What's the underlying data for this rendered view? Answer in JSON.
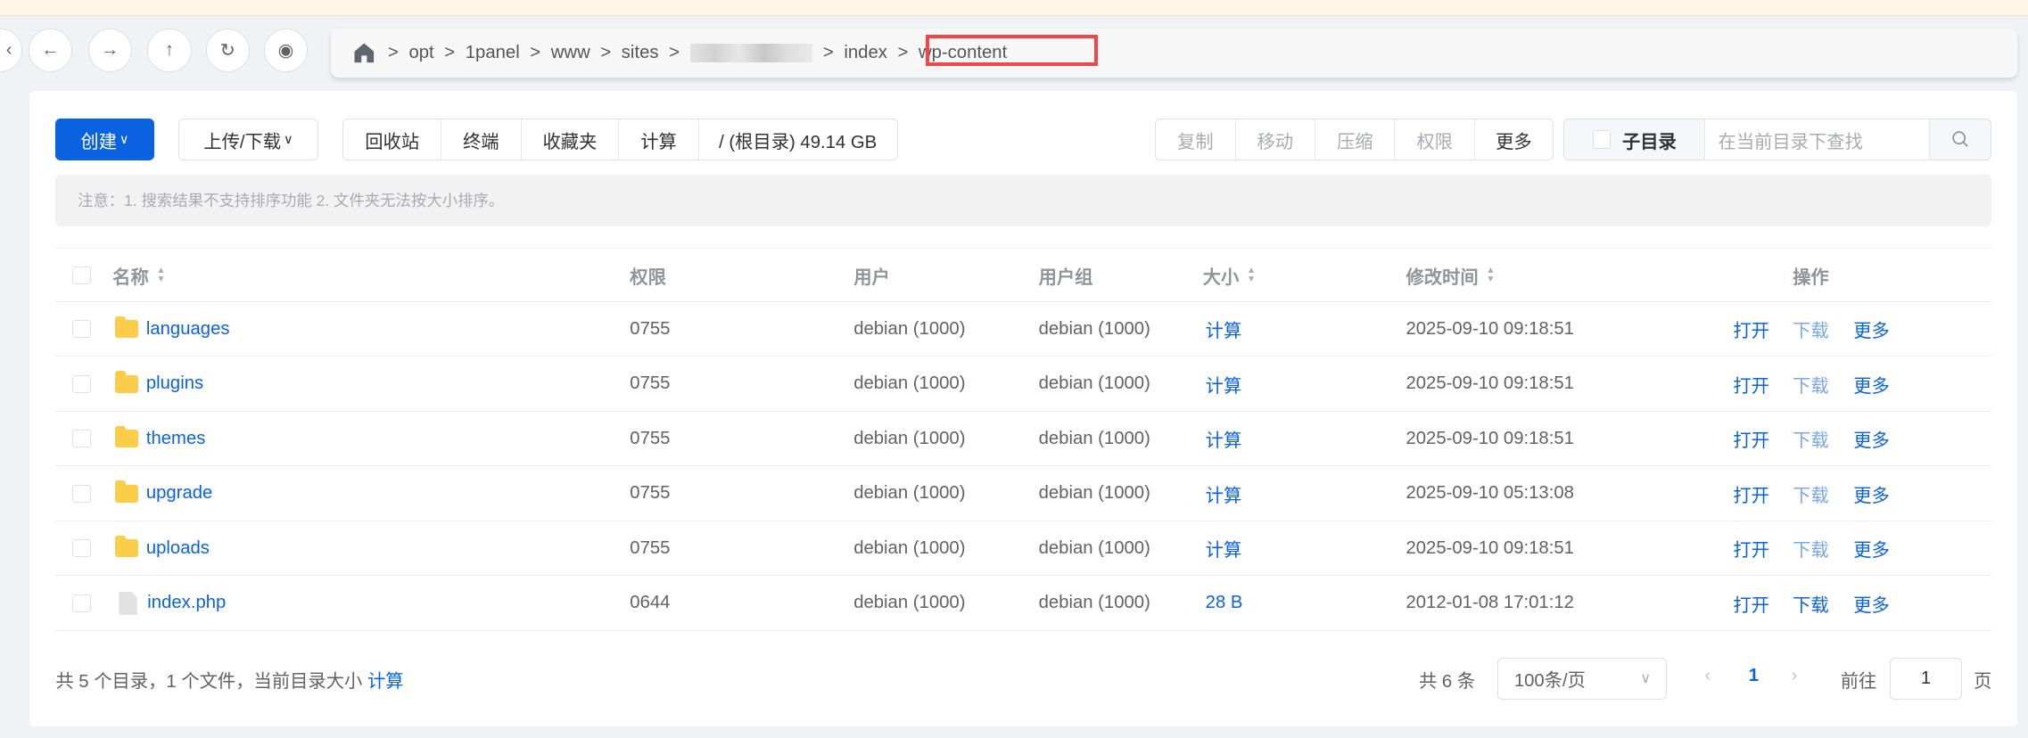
{
  "nav": {
    "back": "←",
    "forward": "→",
    "up": "↑",
    "refresh": "↻",
    "preview": "◉",
    "collapse": "‹"
  },
  "breadcrumb": {
    "items": [
      "opt",
      "1panel",
      "www",
      "sites",
      "index",
      "wp-content"
    ],
    "sep": ">"
  },
  "toolbar": {
    "create": "创建",
    "upload_download": "上传/下载",
    "recycle": "回收站",
    "terminal": "终端",
    "favorites": "收藏夹",
    "calculate": "计算",
    "root_size": "/ (根目录) 49.14 GB",
    "copy": "复制",
    "move": "移动",
    "compress": "压缩",
    "permission": "权限",
    "more": "更多",
    "subdir": "子目录",
    "search_placeholder": "在当前目录下查找"
  },
  "notice": "注意：1. 搜索结果不支持排序功能 2. 文件夹无法按大小排序。",
  "table": {
    "headers": {
      "name": "名称",
      "perm": "权限",
      "user": "用户",
      "group": "用户组",
      "size": "大小",
      "mtime": "修改时间",
      "ops": "操作"
    },
    "rows": [
      {
        "name": "languages",
        "type": "folder",
        "perm": "0755",
        "user": "debian (1000)",
        "group": "debian (1000)",
        "size": "计算",
        "mtime": "2025-09-10 09:18:51"
      },
      {
        "name": "plugins",
        "type": "folder",
        "perm": "0755",
        "user": "debian (1000)",
        "group": "debian (1000)",
        "size": "计算",
        "mtime": "2025-09-10 09:18:51"
      },
      {
        "name": "themes",
        "type": "folder",
        "perm": "0755",
        "user": "debian (1000)",
        "group": "debian (1000)",
        "size": "计算",
        "mtime": "2025-09-10 09:18:51"
      },
      {
        "name": "upgrade",
        "type": "folder",
        "perm": "0755",
        "user": "debian (1000)",
        "group": "debian (1000)",
        "size": "计算",
        "mtime": "2025-09-10 05:13:08"
      },
      {
        "name": "uploads",
        "type": "folder",
        "perm": "0755",
        "user": "debian (1000)",
        "group": "debian (1000)",
        "size": "计算",
        "mtime": "2025-09-10 09:18:51"
      },
      {
        "name": "index.php",
        "type": "file",
        "perm": "0644",
        "user": "debian (1000)",
        "group": "debian (1000)",
        "size": "28 B",
        "mtime": "2012-01-08 17:01:12"
      }
    ],
    "ops": {
      "open": "打开",
      "download": "下载",
      "more": "更多"
    }
  },
  "footer": {
    "summary": "共 5 个目录，1 个文件，当前目录大小",
    "calc": "计算",
    "total": "共 6 条",
    "page_size": "100条/页",
    "current_page": "1",
    "goto": "前往",
    "goto_value": "1",
    "page_unit": "页"
  },
  "colors": {
    "primary": "#0b62e0",
    "highlight": "#f0474a"
  }
}
